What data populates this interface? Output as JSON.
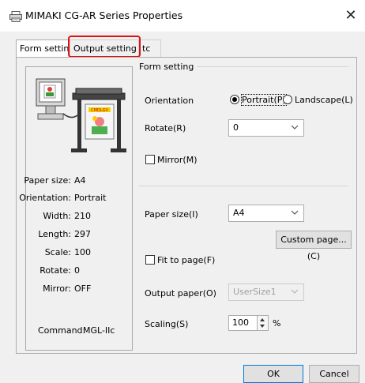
{
  "window": {
    "title": "MIMAKI CG-AR Series Properties"
  },
  "tabs": [
    {
      "label": "Form setting"
    },
    {
      "label": "Output setting"
    },
    {
      "label": "tc"
    }
  ],
  "info": {
    "paper_size_label": "Paper size:",
    "paper_size_value": "A4",
    "orientation_label": "Orientation:",
    "orientation_value": "Portrait",
    "width_label": "Width:",
    "width_value": "210",
    "length_label": "Length:",
    "length_value": "297",
    "scale_label": "Scale:",
    "scale_value": "100",
    "rotate_label": "Rotate:",
    "rotate_value": "0",
    "mirror_label": "Mirror:",
    "mirror_value": "OFF",
    "command_label": "Command:",
    "command_value": "MGL-IIc"
  },
  "form_setting": {
    "group_title": "Form setting",
    "orientation_label": "Orientation",
    "portrait_label": "Portrait(P)",
    "landscape_label": "Landscape(L)",
    "orientation_selected": "portrait",
    "rotate_label": "Rotate(R)",
    "rotate_value": "0",
    "mirror_label": "Mirror(M)",
    "mirror_checked": false,
    "paper_size_label": "Paper size(I)",
    "paper_size_value": "A4",
    "custom_page_label": "Custom page...(C)",
    "fit_to_page_label": "Fit to page(F)",
    "fit_to_page_checked": false,
    "output_paper_label": "Output paper(O)",
    "output_paper_value": "UserSize1",
    "scaling_label": "Scaling(S)",
    "scaling_value": "100",
    "scaling_unit": "%"
  },
  "footer": {
    "ok_label": "OK",
    "cancel_label": "Cancel"
  },
  "icons": {
    "window": "printer-icon",
    "close": "close-icon",
    "dropdown": "chevron-down-icon",
    "spinner": "spin-arrows-icon"
  },
  "colors": {
    "highlight": "#e01010",
    "focus_blue": "#0078d7"
  }
}
